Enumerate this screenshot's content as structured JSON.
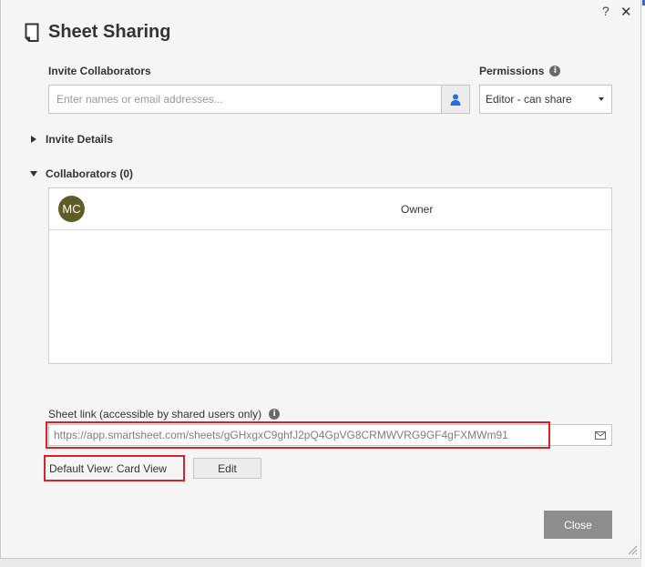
{
  "dialog": {
    "title": "Sheet Sharing",
    "help_label": "?",
    "close_glyph": "✕"
  },
  "invite": {
    "label": "Invite Collaborators",
    "placeholder": "Enter names or email addresses...",
    "value": ""
  },
  "permissions": {
    "label": "Permissions",
    "info": "i",
    "selected": "Editor - can share"
  },
  "invite_details": {
    "label": "Invite Details"
  },
  "collaborators": {
    "header": "Collaborators (0)",
    "items": [
      {
        "initials": "MC",
        "role": "Owner",
        "avatar_color": "#5e5c27"
      }
    ]
  },
  "sheet_link": {
    "label": "Sheet link (accessible by shared users only)",
    "info": "i",
    "url": "https://app.smartsheet.com/sheets/gGHxgxC9ghfJ2pQ4GpVG8CRMWVRG9GF4gFXMWm91"
  },
  "default_view": {
    "label": "Default View: Card View",
    "edit_label": "Edit"
  },
  "footer": {
    "close_label": "Close"
  },
  "colors": {
    "highlight": "#d9212a",
    "close_button": "#8d8d8d",
    "contacts_icon": "#2d6cdf"
  }
}
